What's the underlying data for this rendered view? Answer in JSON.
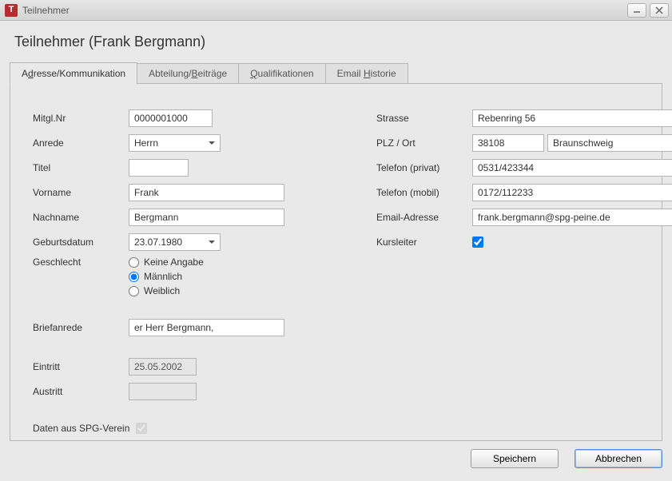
{
  "window": {
    "title": "Teilnehmer",
    "icon_glyph": "T"
  },
  "page": {
    "title": "Teilnehmer (Frank Bergmann)"
  },
  "tabs": [
    {
      "pre": "A",
      "ul": "d",
      "post": "resse/Kommunikation"
    },
    {
      "pre": "Abteilung/",
      "ul": "B",
      "post": "eiträge"
    },
    {
      "pre": "",
      "ul": "Q",
      "post": "ualifikationen"
    },
    {
      "pre": "Email ",
      "ul": "H",
      "post": "istorie"
    }
  ],
  "labels": {
    "mitgl_nr": "Mitgl.Nr",
    "anrede": "Anrede",
    "titel": "Titel",
    "vorname": "Vorname",
    "nachname": "Nachname",
    "geburtsdatum": "Geburtsdatum",
    "geschlecht": "Geschlecht",
    "briefanrede": "Briefanrede",
    "eintritt": "Eintritt",
    "austritt": "Austritt",
    "daten_aus": "Daten aus SPG-Verein",
    "strasse": "Strasse",
    "plz_ort": "PLZ / Ort",
    "telefon_privat": "Telefon (privat)",
    "telefon_mobil": "Telefon (mobil)",
    "email": "Email-Adresse",
    "kursleiter": "Kursleiter"
  },
  "geschlecht_options": {
    "keine": "Keine Angabe",
    "maennlich": "Männlich",
    "weiblich": "Weiblich"
  },
  "values": {
    "mitgl_nr": "0000001000",
    "anrede": "Herrn",
    "titel": "",
    "vorname": "Frank",
    "nachname": "Bergmann",
    "geburtsdatum": "23.07.1980",
    "geschlecht": "maennlich",
    "briefanrede": "er Herr Bergmann,",
    "eintritt": "25.05.2002",
    "austritt": "",
    "daten_aus_checked": true,
    "strasse": "Rebenring 56",
    "plz": "38108",
    "ort": "Braunschweig",
    "telefon_privat": "0531/423344",
    "telefon_mobil": "0172/112233",
    "email": "frank.bergmann@spg-peine.de",
    "kursleiter_checked": true
  },
  "buttons": {
    "save": "Speichern",
    "cancel": "Abbrechen"
  }
}
